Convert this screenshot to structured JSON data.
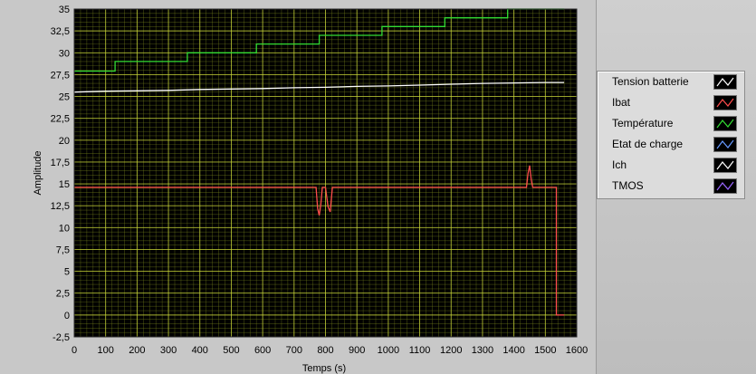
{
  "chart_data": {
    "type": "line",
    "title": "",
    "xlabel": "Temps (s)",
    "ylabel": "Amplitude",
    "xlim": [
      0,
      1600
    ],
    "ylim": [
      -2.5,
      35
    ],
    "x_ticks": [
      0,
      100,
      200,
      300,
      400,
      500,
      600,
      700,
      800,
      900,
      1000,
      1100,
      1200,
      1300,
      1400,
      1500,
      1600
    ],
    "y_ticks": [
      -2.5,
      0,
      2.5,
      5,
      7.5,
      10,
      12.5,
      15,
      17.5,
      20,
      22.5,
      25,
      27.5,
      30,
      32.5,
      35
    ],
    "y_tick_labels": [
      "-2,5",
      "0",
      "2,5",
      "5",
      "7,5",
      "10",
      "12,5",
      "15",
      "17,5",
      "20",
      "22,5",
      "25",
      "27,5",
      "30",
      "32,5",
      "35"
    ],
    "grid": true,
    "plot_background": "#000000",
    "grid_color": "#7e8a1e",
    "legend_position": "right",
    "series": [
      {
        "name": "Tension batterie",
        "color": "#ffffff",
        "points": [
          [
            0,
            25.5
          ],
          [
            100,
            25.6
          ],
          [
            200,
            25.65
          ],
          [
            300,
            25.7
          ],
          [
            400,
            25.8
          ],
          [
            500,
            25.85
          ],
          [
            600,
            25.9
          ],
          [
            700,
            26.0
          ],
          [
            800,
            26.05
          ],
          [
            900,
            26.15
          ],
          [
            1000,
            26.2
          ],
          [
            1100,
            26.3
          ],
          [
            1200,
            26.4
          ],
          [
            1300,
            26.5
          ],
          [
            1400,
            26.55
          ],
          [
            1500,
            26.6
          ],
          [
            1560,
            26.6
          ]
        ]
      },
      {
        "name": "Ibat",
        "color": "#ff4d4d",
        "points": [
          [
            0,
            14.6
          ],
          [
            770,
            14.6
          ],
          [
            775,
            12.2
          ],
          [
            780,
            11.4
          ],
          [
            785,
            12.6
          ],
          [
            790,
            14.6
          ],
          [
            800,
            14.6
          ],
          [
            808,
            12.4
          ],
          [
            815,
            11.8
          ],
          [
            822,
            14.6
          ],
          [
            1440,
            14.6
          ],
          [
            1445,
            16.2
          ],
          [
            1450,
            17.1
          ],
          [
            1455,
            15.5
          ],
          [
            1460,
            14.6
          ],
          [
            1535,
            14.6
          ],
          [
            1535,
            0
          ],
          [
            1560,
            0
          ]
        ]
      },
      {
        "name": "Température",
        "color": "#33dd33",
        "points": [
          [
            0,
            27.9
          ],
          [
            130,
            27.9
          ],
          [
            130,
            29
          ],
          [
            360,
            29
          ],
          [
            360,
            30
          ],
          [
            580,
            30
          ],
          [
            580,
            31
          ],
          [
            780,
            31
          ],
          [
            780,
            32
          ],
          [
            980,
            32
          ],
          [
            980,
            33
          ],
          [
            1180,
            33
          ],
          [
            1180,
            34
          ],
          [
            1380,
            34
          ],
          [
            1380,
            35
          ],
          [
            1560,
            35
          ]
        ]
      },
      {
        "name": "Etat de charge",
        "color": "#6699ff",
        "points": []
      },
      {
        "name": "Ich",
        "color": "#ffffff",
        "points": []
      },
      {
        "name": "TMOS",
        "color": "#9966ff",
        "points": []
      }
    ]
  }
}
